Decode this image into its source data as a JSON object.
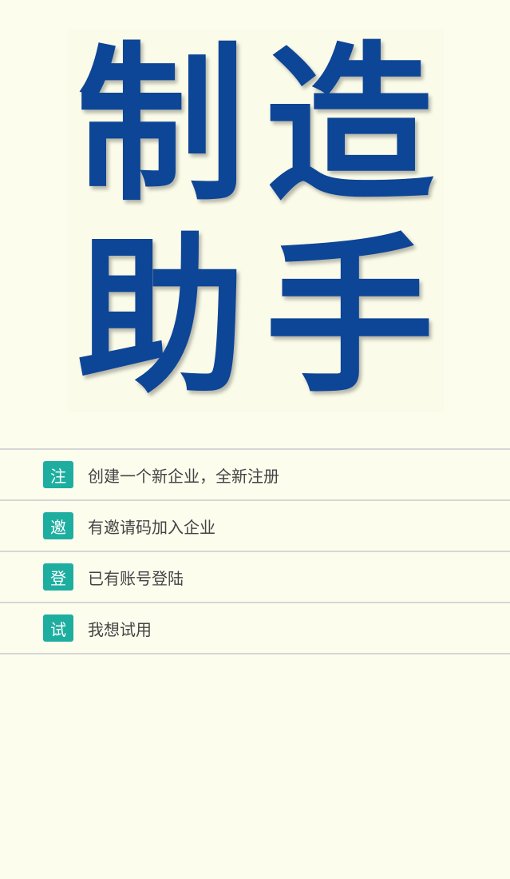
{
  "logo": {
    "chars": [
      "制",
      "造",
      "助",
      "手"
    ]
  },
  "menu": {
    "items": [
      {
        "badge": "注",
        "label": "创建一个新企业，全新注册"
      },
      {
        "badge": "邀",
        "label": "有邀请码加入企业"
      },
      {
        "badge": "登",
        "label": "已有账号登陆"
      },
      {
        "badge": "试",
        "label": "我想试用"
      }
    ]
  },
  "colors": {
    "background": "#fdfdee",
    "logo_text": "#0d4597",
    "badge": "#1eaea0",
    "divider": "#d6d6d6",
    "label_text": "#444444"
  }
}
